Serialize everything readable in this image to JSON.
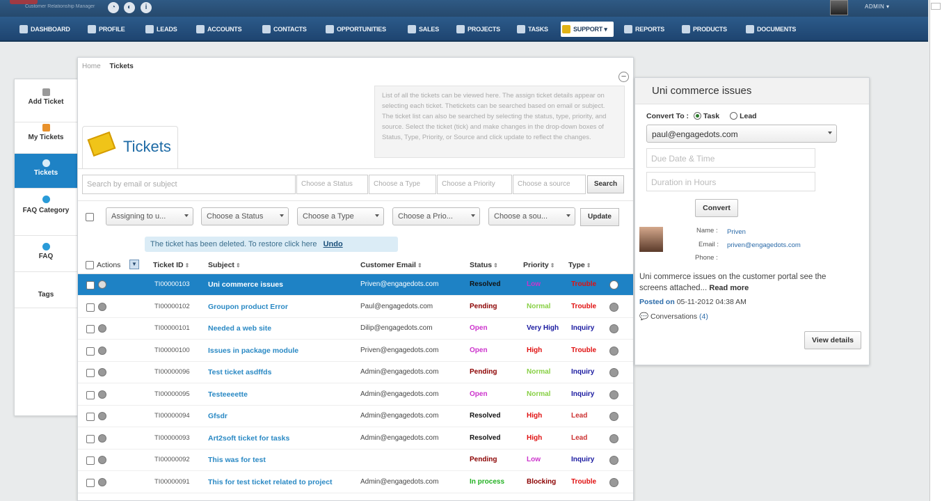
{
  "header": {
    "admin_label": "ADMIN ▾",
    "logo_tagline": "Customer Relationship Manager",
    "icons": [
      "globe-icon",
      "refresh-icon",
      "info-icon"
    ]
  },
  "nav": {
    "items": [
      {
        "label": "DASHBOARD",
        "icon": "dashboard-icon"
      },
      {
        "label": "PROFILE",
        "icon": "profile-icon"
      },
      {
        "label": "LEADS",
        "icon": "leads-icon"
      },
      {
        "label": "ACCOUNTS",
        "icon": "accounts-icon"
      },
      {
        "label": "CONTACTS",
        "icon": "contacts-icon"
      },
      {
        "label": "OPPORTUNITIES",
        "icon": "opportunities-icon"
      },
      {
        "label": "SALES",
        "icon": "sales-icon"
      },
      {
        "label": "PROJECTS",
        "icon": "projects-icon"
      },
      {
        "label": "TASKS",
        "icon": "tasks-icon"
      },
      {
        "label": "SUPPORT ▾",
        "icon": "support-icon",
        "active": true
      },
      {
        "label": "REPORTS",
        "icon": "reports-icon"
      },
      {
        "label": "PRODUCTS",
        "icon": "products-icon"
      },
      {
        "label": "DOCUMENTS",
        "icon": "documents-icon"
      }
    ]
  },
  "sidebar": {
    "items": [
      {
        "label": "Add Ticket",
        "icon": "add-ticket-icon"
      },
      {
        "label": "My Tickets",
        "icon": "my-tickets-icon"
      },
      {
        "label": "Tickets",
        "icon": "tickets-icon",
        "active": true
      },
      {
        "label": "FAQ Category",
        "icon": "faq-category-icon"
      },
      {
        "label": "FAQ",
        "icon": "faq-icon"
      },
      {
        "label": "Tags",
        "icon": ""
      }
    ]
  },
  "breadcrumb": {
    "home": "Home",
    "current": "Tickets"
  },
  "help_text": "List of all the tickets can be viewed here. The assign ticket details appear on selecting each ticket. Thetickets can be searched based on email or subject. The ticket list can also be searched by selecting the status, type, priority, and source. Select the ticket (tick) and make changes in the drop-down boxes of Status, Type, Priority, or Source and click update to reflect the changes.",
  "page_title": "Tickets",
  "search": {
    "placeholder": "Search by email or subject",
    "status": "Choose a Status",
    "type": "Choose a Type",
    "priority": "Choose a Priority",
    "source": "Choose a source",
    "button": "Search"
  },
  "bulk": {
    "assign": "Assigning to u...",
    "status": "Choose a Status",
    "type": "Choose a Type",
    "priority": "Choose a Prio...",
    "source": "Choose a sou...",
    "update": "Update"
  },
  "notice": {
    "text": "The ticket has been deleted. To restore click here",
    "undo": "Undo"
  },
  "table": {
    "headers": {
      "actions": "Actions",
      "id": "Ticket ID",
      "subject": "Subject",
      "email": "Customer Email",
      "status": "Status",
      "priority": "Priority",
      "type": "Type"
    },
    "rows": [
      {
        "id": "TI00000103",
        "subject": "Uni commerce issues",
        "email": "Priven@engagedots.com",
        "status": "Resolved",
        "priority": "Low",
        "type": "Trouble",
        "selected": true
      },
      {
        "id": "TI00000102",
        "subject": "Groupon product Error",
        "email": "Paul@engagedots.com",
        "status": "Pending",
        "priority": "Normal",
        "type": "Trouble"
      },
      {
        "id": "TI00000101",
        "subject": "Needed a web site",
        "email": "Dilip@engagedots.com",
        "status": "Open",
        "priority": "Very High",
        "type": "Inquiry"
      },
      {
        "id": "TI00000100",
        "subject": "Issues in package module",
        "email": "Priven@engagedots.com",
        "status": "Open",
        "priority": "High",
        "type": "Trouble"
      },
      {
        "id": "TI00000096",
        "subject": "Test ticket asdffds",
        "email": "Admin@engagedots.com",
        "status": "Pending",
        "priority": "Normal",
        "type": "Inquiry"
      },
      {
        "id": "TI00000095",
        "subject": "Testeeeette",
        "email": "Admin@engagedots.com",
        "status": "Open",
        "priority": "Normal",
        "type": "Inquiry"
      },
      {
        "id": "TI00000094",
        "subject": "Gfsdr",
        "email": "Admin@engagedots.com",
        "status": "Resolved",
        "priority": "High",
        "type": "Lead"
      },
      {
        "id": "TI00000093",
        "subject": "Art2soft ticket for tasks",
        "email": "Admin@engagedots.com",
        "status": "Resolved",
        "priority": "High",
        "type": "Lead"
      },
      {
        "id": "TI00000092",
        "subject": "This was for test",
        "email": "",
        "status": "Pending",
        "priority": "Low",
        "type": "Inquiry"
      },
      {
        "id": "TI00000091",
        "subject": "This for test ticket related to project",
        "email": "Admin@engagedots.com",
        "status": "In process",
        "priority": "Blocking",
        "type": "Trouble"
      }
    ]
  },
  "colors": {
    "status": {
      "Resolved": "#111111",
      "Pending": "#8b0000",
      "Open": "#cc33cc",
      "In process": "#22b022"
    },
    "priority": {
      "Low": "#cc33cc",
      "Normal": "#88d045",
      "Very High": "#1a1aa0",
      "High": "#e01010",
      "Blocking": "#8b0000"
    },
    "type": {
      "Trouble": "#e01010",
      "Inquiry": "#1a1aa0",
      "Lead": "#cc3333"
    },
    "selected_row": "#1e82c5",
    "nav_bg": "#24507d"
  },
  "detail": {
    "title": "Uni commerce issues",
    "convert_label": "Convert To :",
    "opt_task": "Task",
    "opt_lead": "Lead",
    "assignee": "paul@engagedots.com",
    "due_placeholder": "Due Date & Time",
    "duration_placeholder": "Duration in Hours",
    "convert_button": "Convert",
    "name_label": "Name :",
    "name": "Priven",
    "email_label": "Email :",
    "email": "priven@engagedots.com",
    "phone_label": "Phone :",
    "description": "Uni commerce issues on the customer portal see the screens attached...",
    "read_more": "Read more",
    "posted_label": "Posted on",
    "posted_date": "05-11-2012 04:38 AM",
    "conversations": "Conversations",
    "conversations_count": "(4)",
    "view_details": "View details"
  }
}
